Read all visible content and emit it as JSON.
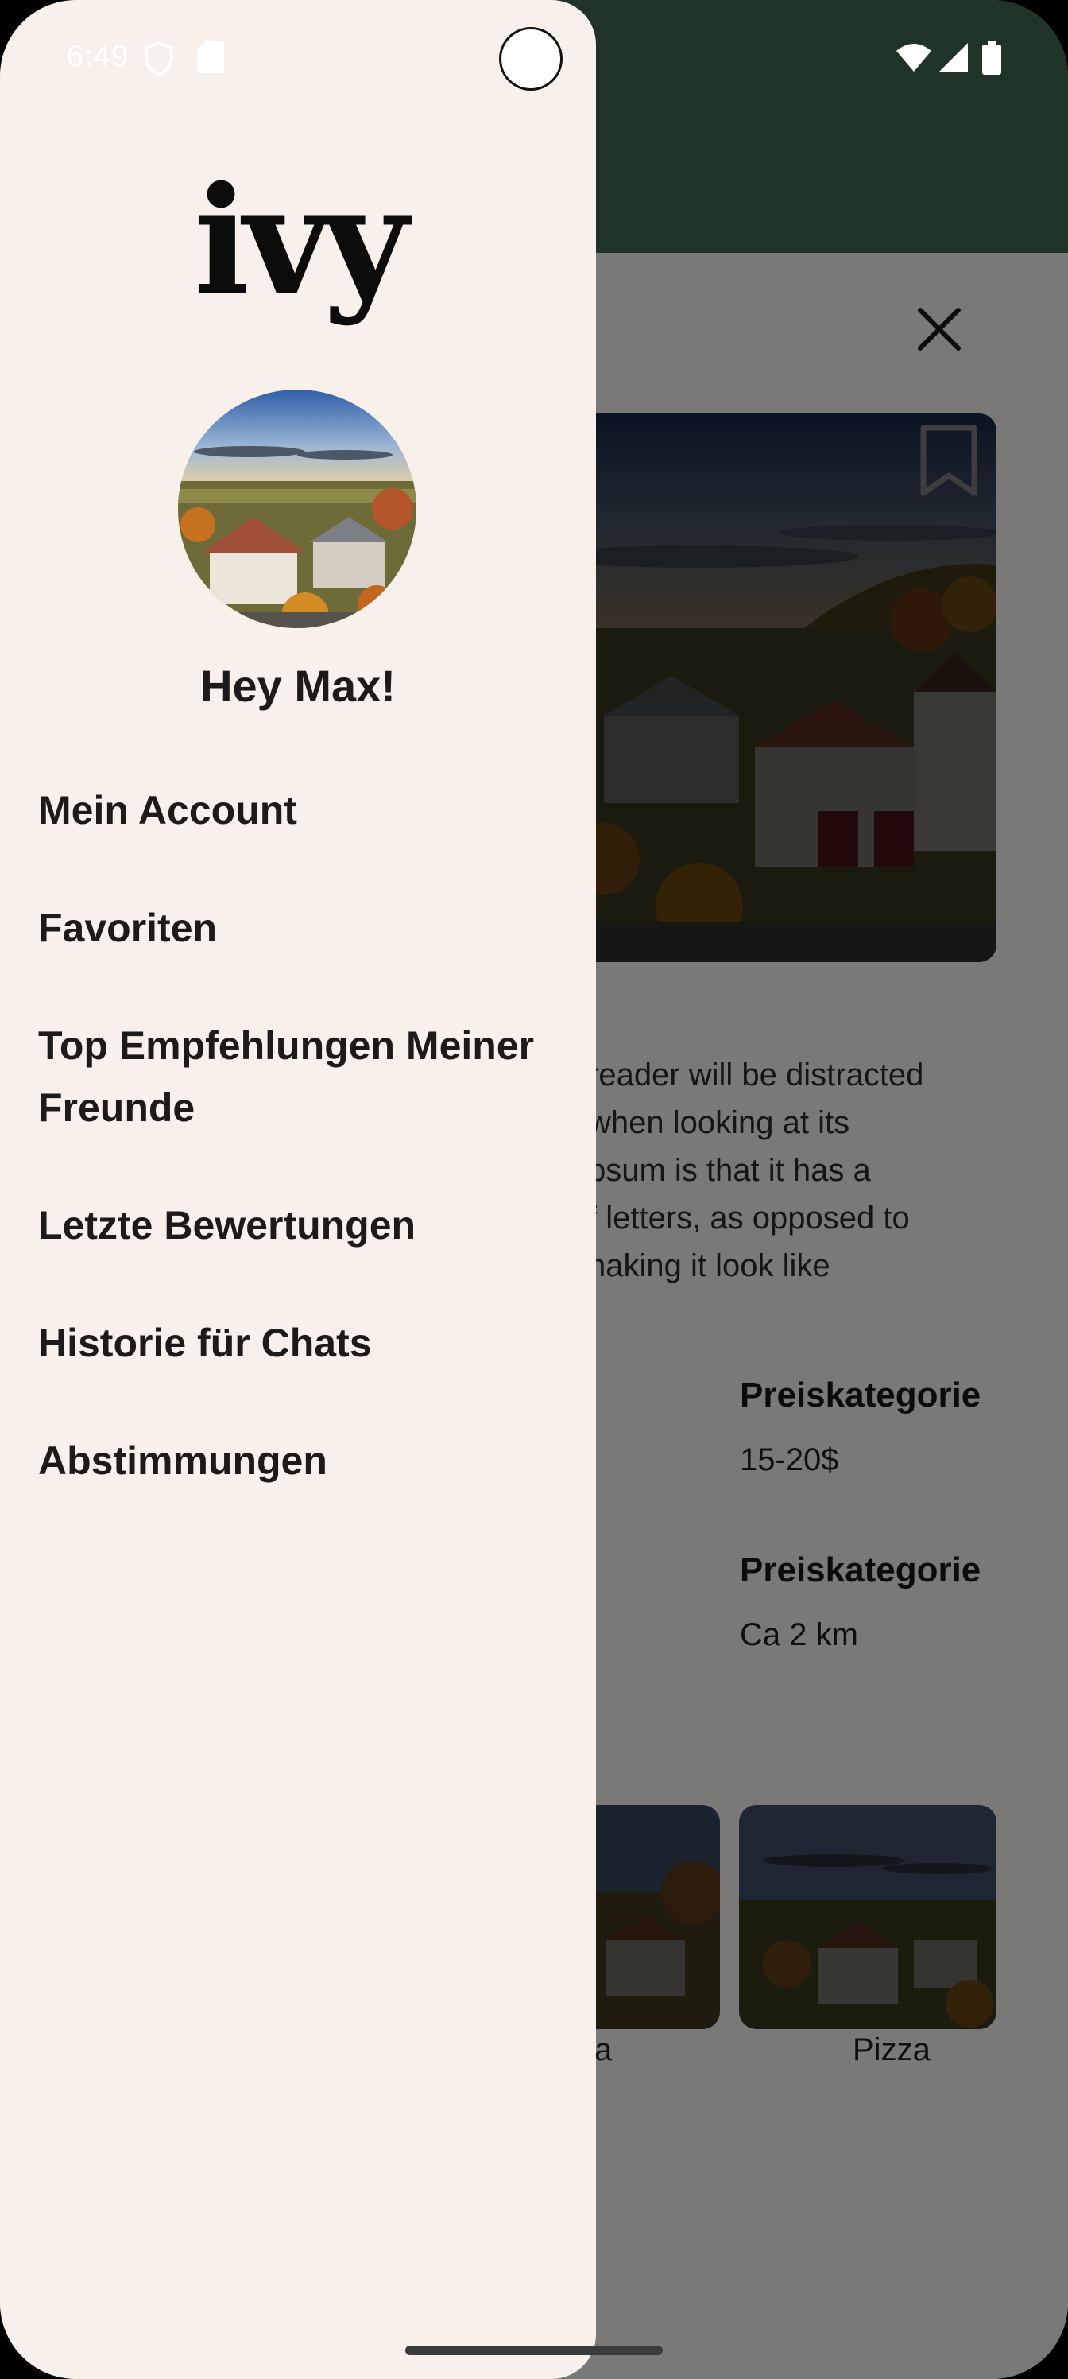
{
  "status_bar": {
    "time": "6:49"
  },
  "drawer": {
    "logo": "ivy",
    "greeting": "Hey Max!",
    "menu_items": [
      "Mein Account",
      "Favoriten",
      "Top Empfehlungen Meiner Freunde",
      "Letzte Bewertungen",
      "Historie für Chats",
      "Abstimmungen"
    ]
  },
  "background": {
    "description": "reader will be distracted\nwhen looking at its\npsum is that it has a\nf letters, as opposed to\nnaking it look like",
    "info": [
      {
        "label": "Preiskategorie",
        "value": "15-20$"
      },
      {
        "label": "Preiskategorie",
        "value": "Ca 2 km"
      }
    ],
    "thumbnails": [
      "a",
      "Pizza"
    ]
  },
  "colors": {
    "header": "#1f3328",
    "drawer_bg": "#f8f1eb",
    "scrim": "rgba(0,0,0,0.5)"
  },
  "icons": [
    "close-icon",
    "bookmark-icon",
    "shield-icon",
    "sd-card-icon",
    "wifi-icon",
    "signal-icon",
    "battery-icon"
  ]
}
